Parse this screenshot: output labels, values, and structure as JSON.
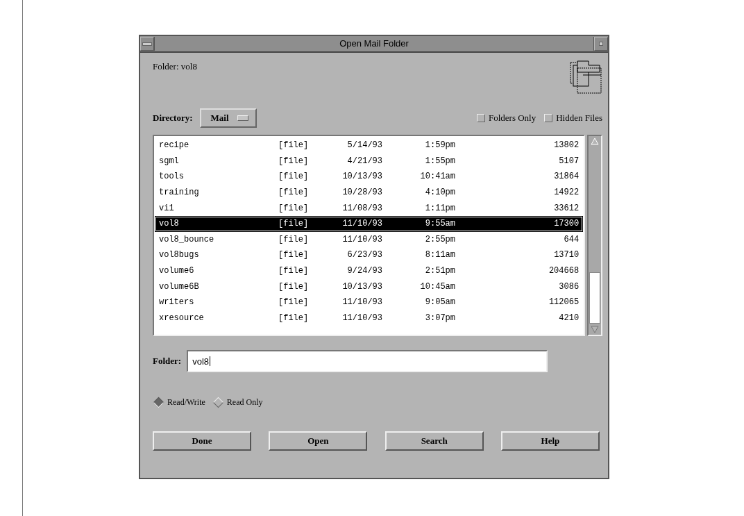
{
  "window": {
    "title": "Open Mail Folder"
  },
  "current_folder": "Folder: vol8",
  "directory": {
    "label": "Directory:",
    "value": "Mail"
  },
  "checkboxes": [
    {
      "label": "Folders Only",
      "checked": false
    },
    {
      "label": "Hidden Files",
      "checked": false
    }
  ],
  "files": [
    {
      "name": "recipe",
      "type": "[file]",
      "date": "5/14/93",
      "time": "1:59pm",
      "size": "13802",
      "selected": false
    },
    {
      "name": "sgml",
      "type": "[file]",
      "date": "4/21/93",
      "time": "1:55pm",
      "size": "5107",
      "selected": false
    },
    {
      "name": "tools",
      "type": "[file]",
      "date": "10/13/93",
      "time": "10:41am",
      "size": "31864",
      "selected": false
    },
    {
      "name": "training",
      "type": "[file]",
      "date": "10/28/93",
      "time": "4:10pm",
      "size": "14922",
      "selected": false
    },
    {
      "name": "vi1",
      "type": "[file]",
      "date": "11/08/93",
      "time": "1:11pm",
      "size": "33612",
      "selected": false
    },
    {
      "name": "vol8",
      "type": "[file]",
      "date": "11/10/93",
      "time": "9:55am",
      "size": "17300",
      "selected": true
    },
    {
      "name": "vol8_bounce",
      "type": "[file]",
      "date": "11/10/93",
      "time": "2:55pm",
      "size": "644",
      "selected": false
    },
    {
      "name": "vol8bugs",
      "type": "[file]",
      "date": "6/23/93",
      "time": "8:11am",
      "size": "13710",
      "selected": false
    },
    {
      "name": "volume6",
      "type": "[file]",
      "date": "9/24/93",
      "time": "2:51pm",
      "size": "204668",
      "selected": false
    },
    {
      "name": "volume6B",
      "type": "[file]",
      "date": "10/13/93",
      "time": "10:45am",
      "size": "3086",
      "selected": false
    },
    {
      "name": "writers",
      "type": "[file]",
      "date": "11/10/93",
      "time": "9:05am",
      "size": "112065",
      "selected": false
    },
    {
      "name": "xresource",
      "type": "[file]",
      "date": "11/10/93",
      "time": "3:07pm",
      "size": "4210",
      "selected": false
    }
  ],
  "folder_field": {
    "label": "Folder:",
    "value": "vol8"
  },
  "radios": [
    {
      "label": "Read/Write",
      "selected": true
    },
    {
      "label": "Read Only",
      "selected": false
    }
  ],
  "buttons": [
    "Done",
    "Open",
    "Search",
    "Help"
  ]
}
